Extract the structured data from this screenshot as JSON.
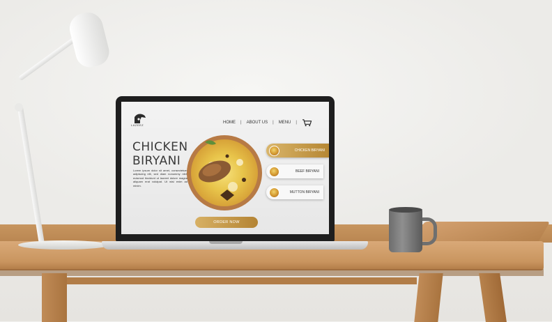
{
  "site": {
    "logo_text": "LAZEEZ",
    "nav": {
      "items": [
        "HOME",
        "ABOUT US",
        "MENU"
      ],
      "separator": "|",
      "cart_icon": "cart-icon"
    },
    "hero": {
      "title_line1": "CHICKEN",
      "title_line2": "BIRYANI",
      "description": "Lorem ipsum dolor sit amet, consectetuer adipiscing elit, sed diam nonummy nibh euismod tincidunt ut laoreet dolore magna aliquam erat volutpat. Ut wisi enim ad minim."
    },
    "menu": [
      {
        "label": "CHICKEN BIRYANI",
        "active": true
      },
      {
        "label": "BEEF BIRYANI",
        "active": false
      },
      {
        "label": "MUTTON BIRYANI",
        "active": false
      }
    ],
    "order_button": "ORDER NOW"
  },
  "colors": {
    "accent_gold": "#c79a4a",
    "text_dark": "#3a3a3a",
    "screen_bg": "#efefef"
  }
}
